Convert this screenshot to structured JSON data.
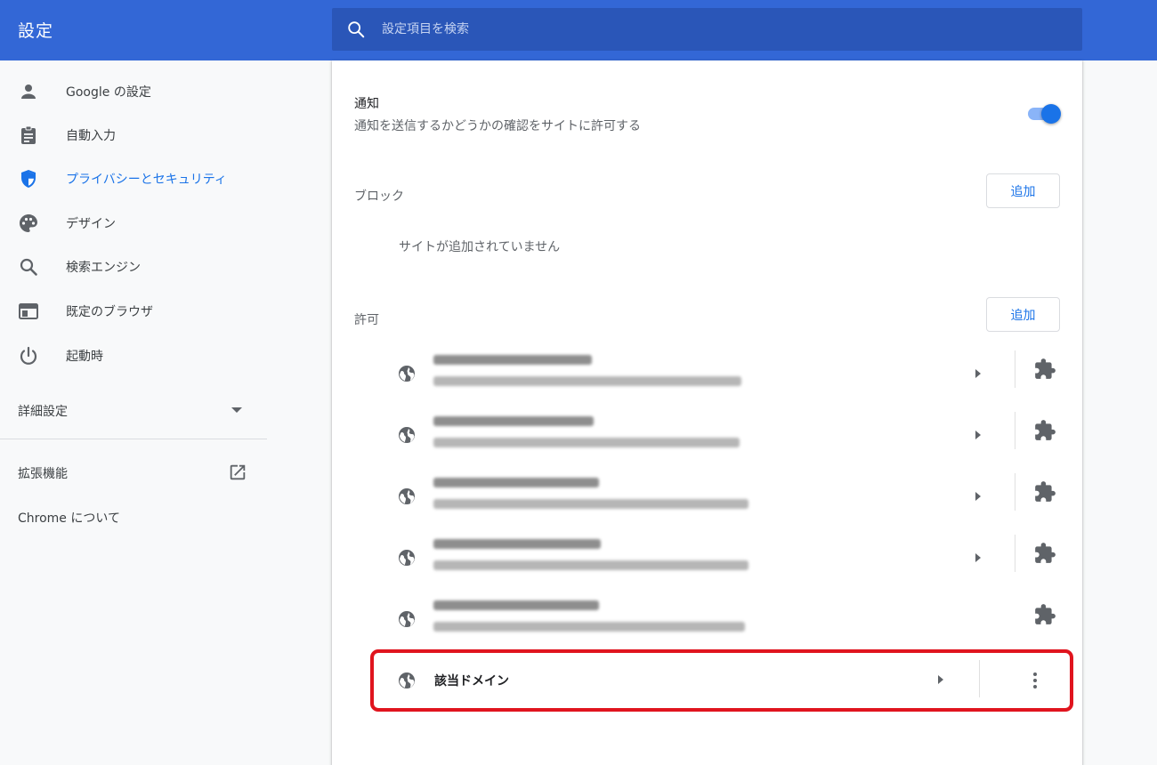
{
  "header": {
    "title": "設定",
    "search_placeholder": "設定項目を検索"
  },
  "sidebar": {
    "items": [
      {
        "label": "Google の設定",
        "icon": "person-icon"
      },
      {
        "label": "自動入力",
        "icon": "clipboard-icon"
      },
      {
        "label": "プライバシーとセキュリティ",
        "icon": "shield-icon",
        "active": true
      },
      {
        "label": "デザイン",
        "icon": "palette-icon"
      },
      {
        "label": "検索エンジン",
        "icon": "search-icon"
      },
      {
        "label": "既定のブラウザ",
        "icon": "browser-window-icon"
      },
      {
        "label": "起動時",
        "icon": "power-icon"
      }
    ],
    "advanced_label": "詳細設定",
    "extensions_label": "拡張機能",
    "about_label": "Chrome について"
  },
  "notifications": {
    "title": "通知",
    "description": "通知を送信するかどうかの確認をサイトに許可する",
    "enabled": true
  },
  "block": {
    "title": "ブロック",
    "add_label": "追加",
    "empty_message": "サイトが追加されていません"
  },
  "allow": {
    "title": "許可",
    "add_label": "追加",
    "target_domain_label": "該当ドメイン"
  },
  "colors": {
    "header": "#3367d6",
    "search_box": "#2a56b8",
    "accent": "#1a73e8",
    "highlight_border": "#e0141e"
  }
}
